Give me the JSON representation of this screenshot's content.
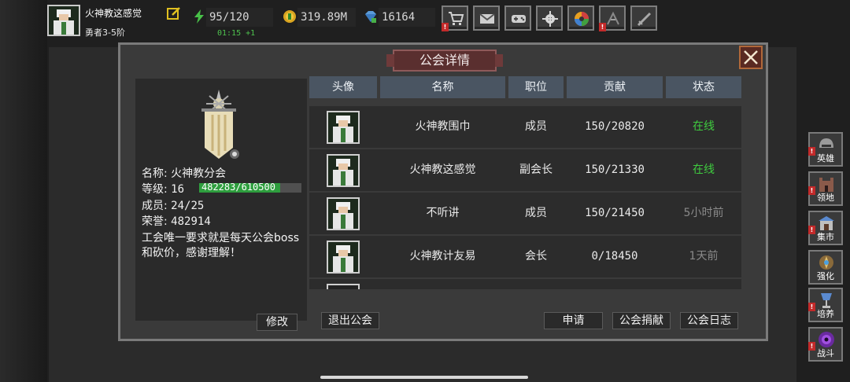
{
  "hero": {
    "name": "火神教这感觉",
    "rank": "勇者3-5阶"
  },
  "stats": {
    "energy": "95/120",
    "energy_timer": "01:15 +1",
    "gold": "319.89M",
    "gems": "16164"
  },
  "toolbar": {
    "icons": [
      "cart-icon",
      "mail-icon",
      "gamepad-icon",
      "gear-icon",
      "aperture-icon",
      "dark-icon",
      "sword-icon"
    ]
  },
  "dialog": {
    "title": "公会详情"
  },
  "guild": {
    "name_label": "名称:",
    "name": "火神教分会",
    "level_label": "等级:",
    "level": "16",
    "exp_text": "482283/610500",
    "exp_fraction": 0.79,
    "members_label": "成员:",
    "members": "24/25",
    "honor_label": "荣誉:",
    "honor": "482914",
    "motto": "工会唯一要求就是每天公会boss和砍价，感谢理解！",
    "modify_label": "修改"
  },
  "table": {
    "headers": [
      "头像",
      "名称",
      "职位",
      "贡献",
      "状态"
    ],
    "rows": [
      {
        "name": "火神教围巾",
        "role": "成员",
        "contrib": "150/20820",
        "status": "在线",
        "online": true
      },
      {
        "name": "火神教这感觉",
        "role": "副会长",
        "contrib": "150/21330",
        "status": "在线",
        "online": true
      },
      {
        "name": "不听讲",
        "role": "成员",
        "contrib": "150/21450",
        "status": "5小时前",
        "online": false
      },
      {
        "name": "火神教计友易",
        "role": "会长",
        "contrib": "0/18450",
        "status": "1天前",
        "online": false
      }
    ]
  },
  "buttons": {
    "leave": "退出公会",
    "apply": "申请",
    "donate": "公会捐献",
    "log": "公会日志"
  },
  "sidebar": {
    "items": [
      {
        "label": "英雄"
      },
      {
        "label": "领地"
      },
      {
        "label": "集市"
      },
      {
        "label": "强化"
      },
      {
        "label": "培养"
      },
      {
        "label": "战斗"
      }
    ]
  },
  "colors": {
    "online": "#3fcc3f",
    "exp_fill": "#2e9e3e",
    "header_bg": "#4a5562",
    "warning": "#c32a2a"
  }
}
